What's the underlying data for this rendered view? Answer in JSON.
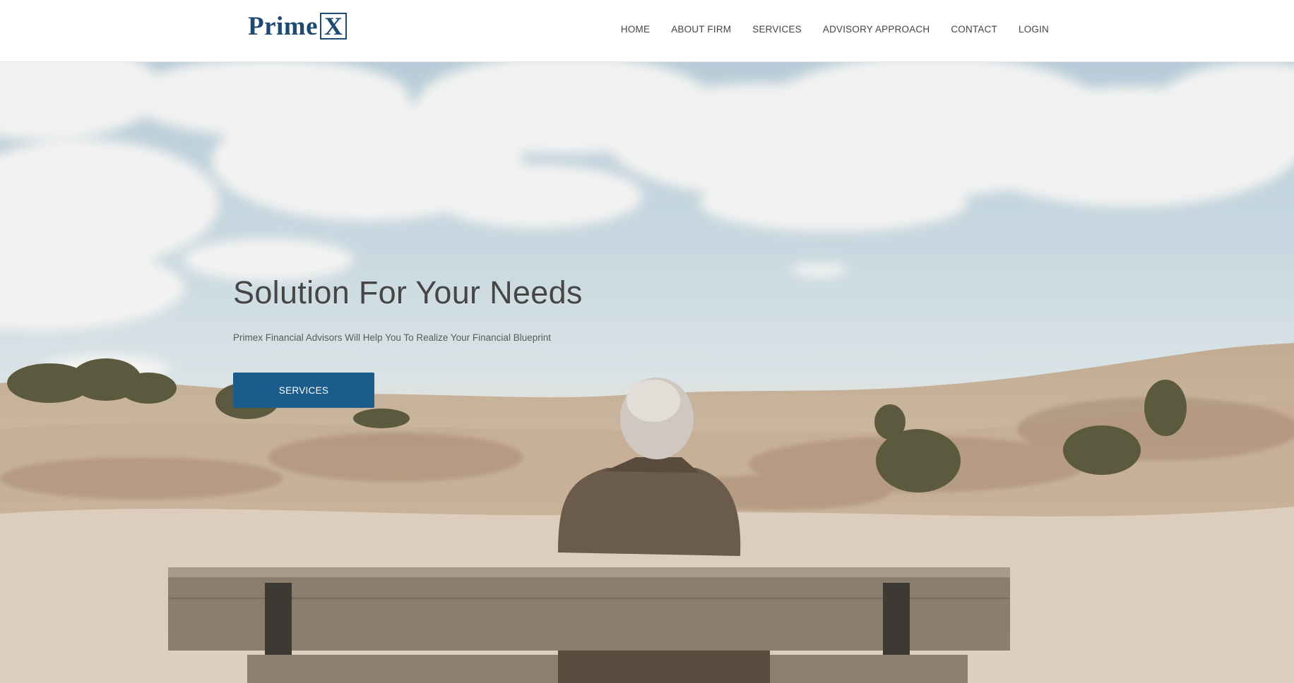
{
  "header": {
    "logo_text": "Prime",
    "logo_mark": "X",
    "nav": [
      {
        "label": "HOME"
      },
      {
        "label": "ABOUT FIRM"
      },
      {
        "label": "SERVICES"
      },
      {
        "label": "ADVISORY APPROACH"
      },
      {
        "label": "CONTACT"
      },
      {
        "label": "LOGIN"
      }
    ]
  },
  "hero": {
    "title": "Solution For Your Needs",
    "subtitle": "Primex Financial Advisors Will Help You To Realize Your Financial Blueprint",
    "button_label": "SERVICES",
    "image": "woman-on-bench-dunes-photo"
  },
  "colors": {
    "brand": "#1c4a72",
    "button": "#1b5c8c",
    "nav_text": "#444444",
    "title_text": "#464646"
  }
}
